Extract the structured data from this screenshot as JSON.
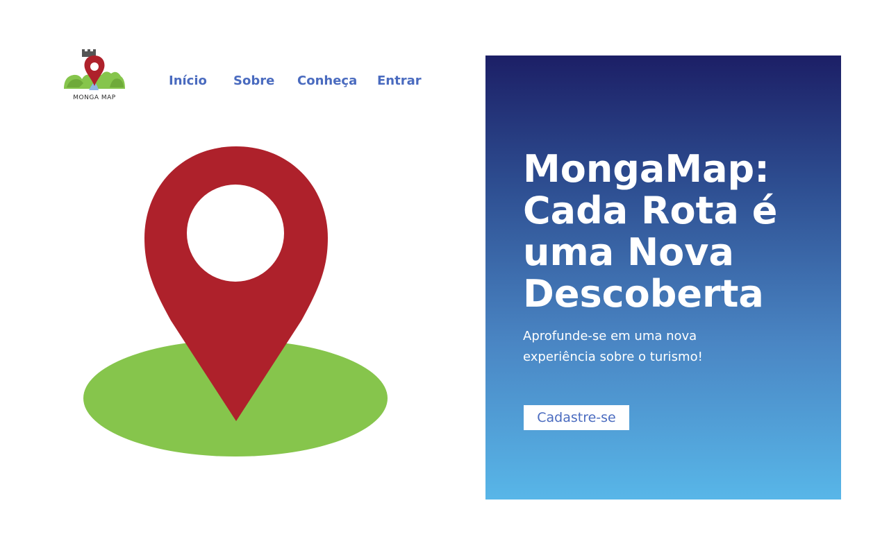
{
  "logo": {
    "text": "MONGA MAP",
    "icon": "map-pin-hills-icon"
  },
  "nav": {
    "items": [
      {
        "label": "Início"
      },
      {
        "label": "Sobre"
      },
      {
        "label": "Conheça"
      },
      {
        "label": "Entrar"
      }
    ]
  },
  "hero": {
    "title": "MongaMap: Cada Rota é uma Nova Descoberta",
    "subtitle": "Aprofunde-se em uma nova experiência sobre o turismo!",
    "cta_label": "Cadastre-se",
    "illustration": "location-pin-icon"
  },
  "colors": {
    "nav_link": "#4a6bbf",
    "pin_red": "#ae212b",
    "ground_green": "#86c54c",
    "panel_top": "#1c1f66",
    "panel_bottom": "#58b6e8",
    "text_white": "#ffffff"
  }
}
